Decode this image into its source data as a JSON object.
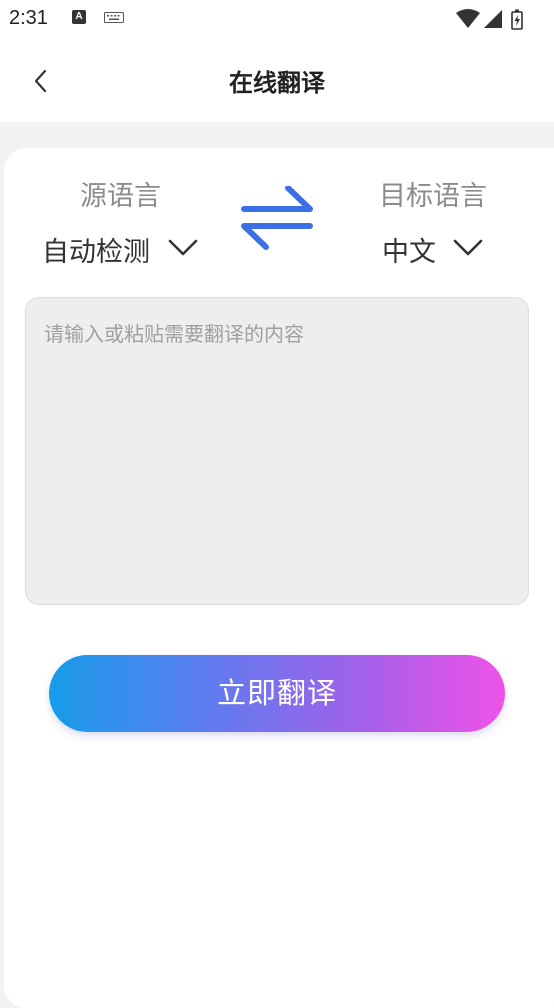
{
  "status_bar": {
    "time": "2:31",
    "notification_icon_letter": "A",
    "icons": [
      "keyboard-icon",
      "wifi-icon",
      "signal-icon",
      "battery-icon"
    ]
  },
  "header": {
    "title": "在线翻译",
    "back_icon": "back-arrow-icon"
  },
  "languages": {
    "source_label": "源语言",
    "source_value": "自动检测",
    "target_label": "目标语言",
    "target_value": "中文",
    "swap_icon": "swap-arrows-icon"
  },
  "input": {
    "value": "",
    "placeholder": "请输入或粘贴需要翻译的内容"
  },
  "action": {
    "translate_label": "立即翻译"
  },
  "colors": {
    "swap_icon": "#3b6fe6",
    "button_gradient_start": "#169ce9",
    "button_gradient_end": "#ef52e8"
  }
}
